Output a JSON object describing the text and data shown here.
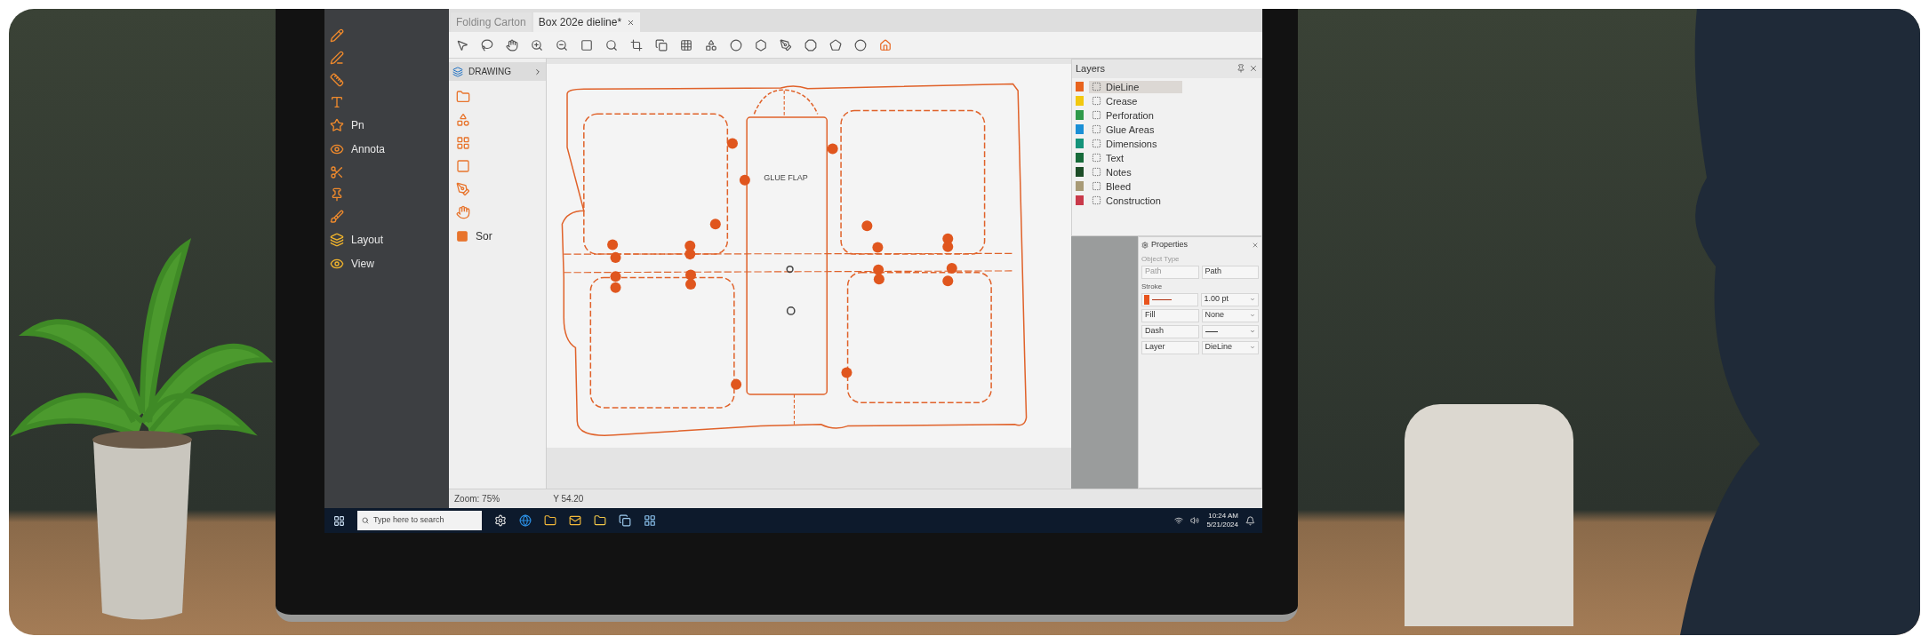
{
  "side_menu": [
    {
      "label": "Pn"
    },
    {
      "label": "Annota"
    },
    {
      "label": "Layout"
    },
    {
      "label": "View"
    }
  ],
  "document_tabs": [
    {
      "label": "Folding Carton",
      "selected": false
    },
    {
      "label": "Box 202e dieline*",
      "selected": true
    }
  ],
  "drawing_panel": {
    "title": "DRAWING",
    "items": [
      {
        "label": "Sor"
      }
    ]
  },
  "canvas": {
    "label": "GLUE FLAP"
  },
  "layers": {
    "title": "Layers",
    "items": [
      {
        "label": "DieLine",
        "color": "#e8641e",
        "selected": true
      },
      {
        "label": "Crease",
        "color": "#f2c80f",
        "selected": false
      },
      {
        "label": "Perforation",
        "color": "#2f9a4a",
        "selected": false
      },
      {
        "label": "Glue Areas",
        "color": "#1a8fd6",
        "selected": false
      },
      {
        "label": "Dimensions",
        "color": "#14937a",
        "selected": false
      },
      {
        "label": "Text",
        "color": "#176b3a",
        "selected": false
      },
      {
        "label": "Notes",
        "color": "#1d4d28",
        "selected": false
      },
      {
        "label": "Bleed",
        "color": "#a89a76",
        "selected": false
      },
      {
        "label": "Construction",
        "color": "#c9394a",
        "selected": false
      }
    ]
  },
  "properties": {
    "title": "Properties",
    "rows": [
      {
        "kind": "type",
        "label": "Object Type",
        "hint": "Path",
        "value": "Path"
      },
      {
        "kind": "stroke",
        "label": "Stroke",
        "value": "1.00 pt"
      },
      {
        "kind": "select",
        "label": "Fill",
        "value": "None"
      },
      {
        "kind": "dash",
        "label": "Dash"
      },
      {
        "kind": "select",
        "label": "Layer",
        "value": "DieLine"
      }
    ]
  },
  "status_bar": {
    "zoom": "Zoom: 75%",
    "coordinate": "Y 54.20"
  },
  "taskbar": {
    "search_placeholder": "Type here to search",
    "time": "10:24 AM",
    "date": "5/21/2024"
  }
}
